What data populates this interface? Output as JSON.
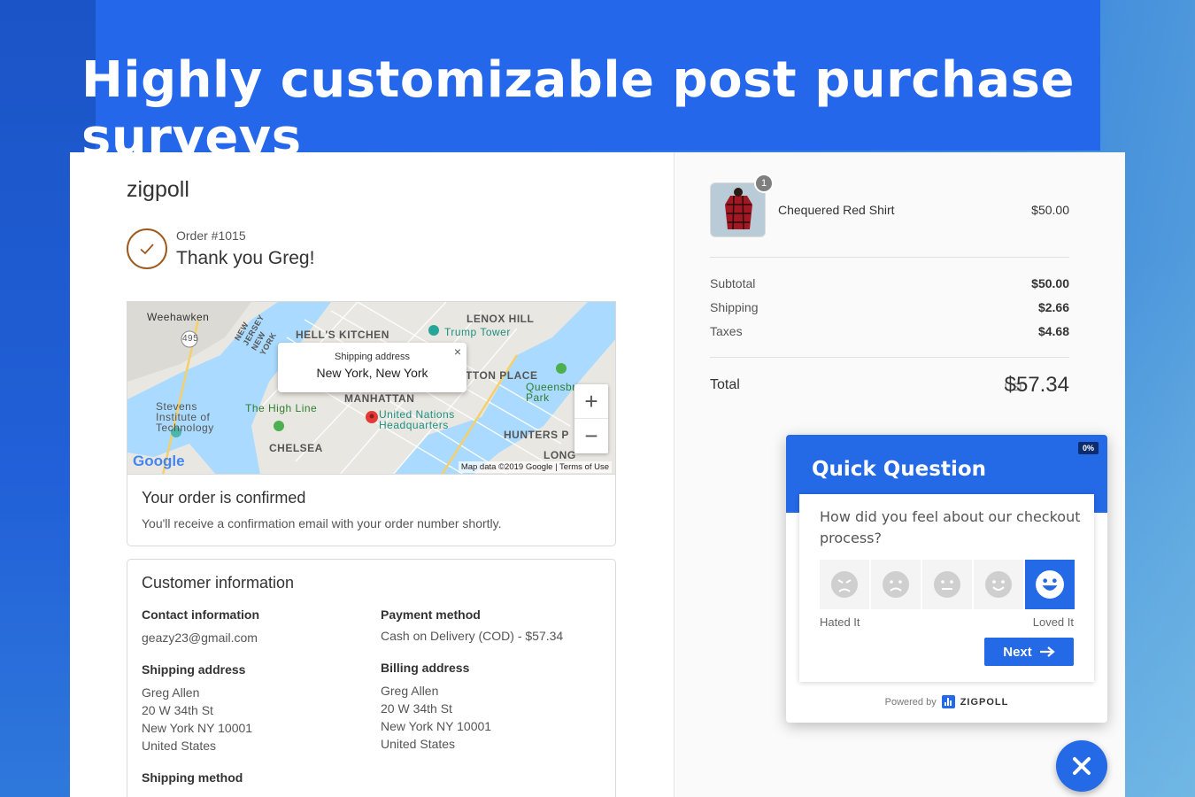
{
  "headline": "Highly customizable post purchase surveys",
  "store": {
    "brand": "zigpoll",
    "order_number": "Order #1015",
    "thank_you": "Thank you Greg!"
  },
  "map": {
    "popup_label": "Shipping address",
    "popup_value": "New York, New York",
    "close_icon": "×",
    "zoom_in": "+",
    "zoom_out": "−",
    "attribution": "Map data ©2019 Google | Terms of Use",
    "google_logo": "Google",
    "labels": {
      "weehawken": "Weehawken",
      "hells_kitchen": "HELL'S KITCHEN",
      "lenox_hill": "LENOX HILL",
      "trump_tower": "Trump Tower",
      "manhattan": "MANHATTAN",
      "stevens": "Stevens Institute of Technology",
      "high_line": "The High Line",
      "un": "United Nations Headquarters",
      "chelsea": "CHELSEA",
      "hunters": "HUNTERS P",
      "long": "LONG",
      "queensbr": "Queensbr Park",
      "nj_ny": "NEW JERSEY NEW YORK",
      "ton_place": "TTON PLACE",
      "route": "495"
    }
  },
  "confirmation": {
    "title": "Your order is confirmed",
    "message": "You'll receive a confirmation email with your order number shortly."
  },
  "customer": {
    "title": "Customer information",
    "contact_label": "Contact information",
    "contact_value": "geazy23@gmail.com",
    "payment_label": "Payment method",
    "payment_value": "Cash on Delivery (COD) - $57.34",
    "shipping_label": "Shipping address",
    "shipping_lines": [
      "Greg Allen",
      "20 W 34th St",
      "New York NY 10001",
      "United States"
    ],
    "billing_label": "Billing address",
    "billing_lines": [
      "Greg Allen",
      "20 W 34th St",
      "New York NY 10001",
      "United States"
    ],
    "method_label": "Shipping method"
  },
  "summary": {
    "product_qty": "1",
    "product_name": "Chequered Red Shirt",
    "product_price": "$50.00",
    "subtotal_label": "Subtotal",
    "subtotal": "$50.00",
    "shipping_label": "Shipping",
    "shipping": "$2.66",
    "taxes_label": "Taxes",
    "taxes": "$4.68",
    "total_label": "Total",
    "currency": "USD",
    "total": "$57.34"
  },
  "survey": {
    "title": "Quick Question",
    "progress": "0%",
    "question": "How did you feel about our checkout process?",
    "faces": [
      "angry-face-icon",
      "sad-face-icon",
      "neutral-face-icon",
      "smile-face-icon",
      "happy-face-icon"
    ],
    "low_label": "Hated It",
    "high_label": "Loved It",
    "next_label": "Next",
    "powered_by": "Powered by",
    "powered_brand": "ZIGPOLL",
    "accent": "#2469e6"
  }
}
